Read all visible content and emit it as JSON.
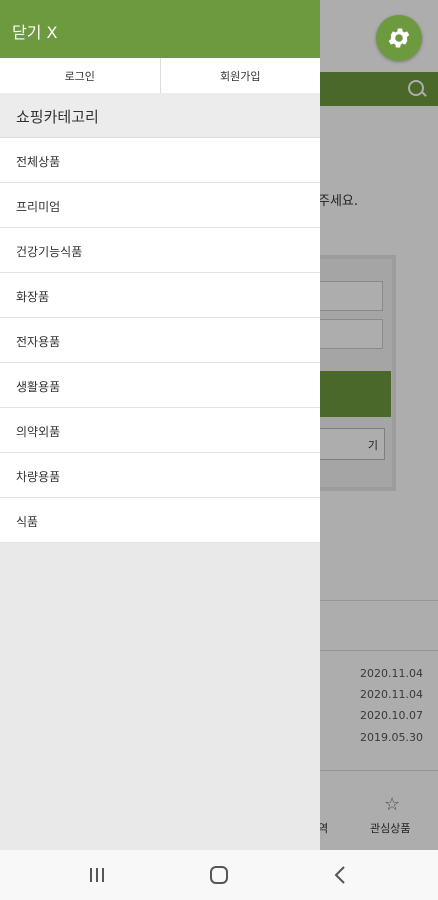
{
  "background": {
    "hint_fragment": "주세요.",
    "outline_button_fragment": "기",
    "dates": [
      "2020.11.04",
      "2020.11.04",
      "2020.10.07",
      "2019.05.30"
    ],
    "bottom_nav": {
      "left_fragment": "역",
      "wishlist_label": "관심상품"
    }
  },
  "drawer": {
    "close_label": "닫기 X",
    "login_label": "로그인",
    "signup_label": "회원가입",
    "category_title": "쇼핑카테고리",
    "categories": [
      "전체상품",
      "프리미엄",
      "건강기능식품",
      "화장품",
      "전자용품",
      "생활용품",
      "의약외품",
      "차량용품",
      "식품"
    ]
  },
  "colors": {
    "brand_green": "#6d9a3f",
    "drawer_bg": "#e9e9e9"
  },
  "icons": {
    "settings": "gear-icon",
    "search": "search-icon",
    "wishlist": "star-icon",
    "recents": "recents-icon",
    "home": "home-icon",
    "back": "back-icon"
  }
}
